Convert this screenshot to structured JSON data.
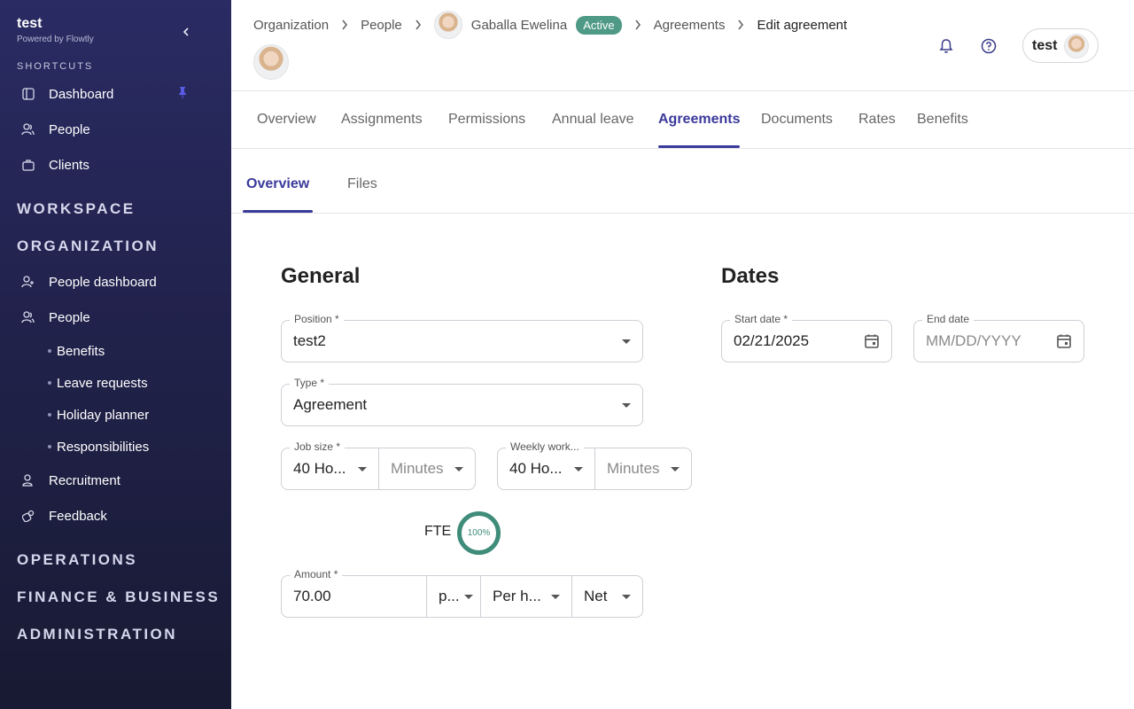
{
  "sidebar": {
    "brand_title": "test",
    "brand_sub": "Powered by Flowtly",
    "shortcuts_title": "SHORTCUTS",
    "shortcuts": [
      {
        "label": "Dashboard",
        "icon": "dashboard-icon"
      },
      {
        "label": "People",
        "icon": "people-icon"
      },
      {
        "label": "Clients",
        "icon": "briefcase-icon"
      }
    ],
    "workspace_title": "WORKSPACE",
    "organization_title": "ORGANIZATION",
    "org_items": [
      {
        "label": "People dashboard",
        "icon": "people-add-icon"
      },
      {
        "label": "People",
        "icon": "people-icon"
      }
    ],
    "people_subitems": [
      "Benefits",
      "Leave requests",
      "Holiday planner",
      "Responsibilities"
    ],
    "org_items_after": [
      {
        "label": "Recruitment",
        "icon": "recruitment-icon"
      },
      {
        "label": "Feedback",
        "icon": "feedback-icon"
      }
    ],
    "operations_title": "OPERATIONS",
    "finance_title": "FINANCE & BUSINESS",
    "admin_title": "ADMINISTRATION"
  },
  "header": {
    "breadcrumbs": [
      "Organization",
      "People",
      "Gaballa Ewelina",
      "Agreements",
      "Edit agreement"
    ],
    "status_badge": "Active",
    "user_name": "test"
  },
  "tabs": [
    "Overview",
    "Assignments",
    "Permissions",
    "Annual leave",
    "Agreements",
    "Documents",
    "Rates",
    "Benefits"
  ],
  "active_tab": "Agreements",
  "subtabs": [
    "Overview",
    "Files"
  ],
  "general": {
    "title": "General",
    "position_label": "Position *",
    "position_value": "test2",
    "type_label": "Type *",
    "type_value": "Agreement",
    "job_size_label": "Job size *",
    "job_size_hours": "40 Ho...",
    "job_size_minutes": "Minutes",
    "weekly_label": "Weekly work...",
    "weekly_hours": "40 Ho...",
    "weekly_minutes": "Minutes",
    "fte_label": "FTE",
    "fte_value": "100%",
    "amount_label": "Amount *",
    "amount_value": "70.00",
    "currency_value": "p...",
    "period_value": "Per h...",
    "net_value": "Net"
  },
  "dates": {
    "title": "Dates",
    "start_label": "Start date *",
    "start_value": "02/21/2025",
    "end_label": "End date",
    "end_placeholder": "MM/DD/YYYY"
  },
  "colors": {
    "accent": "#3b3a9b",
    "badge": "#4f9a86",
    "fte_ring": "#3e8c79"
  }
}
